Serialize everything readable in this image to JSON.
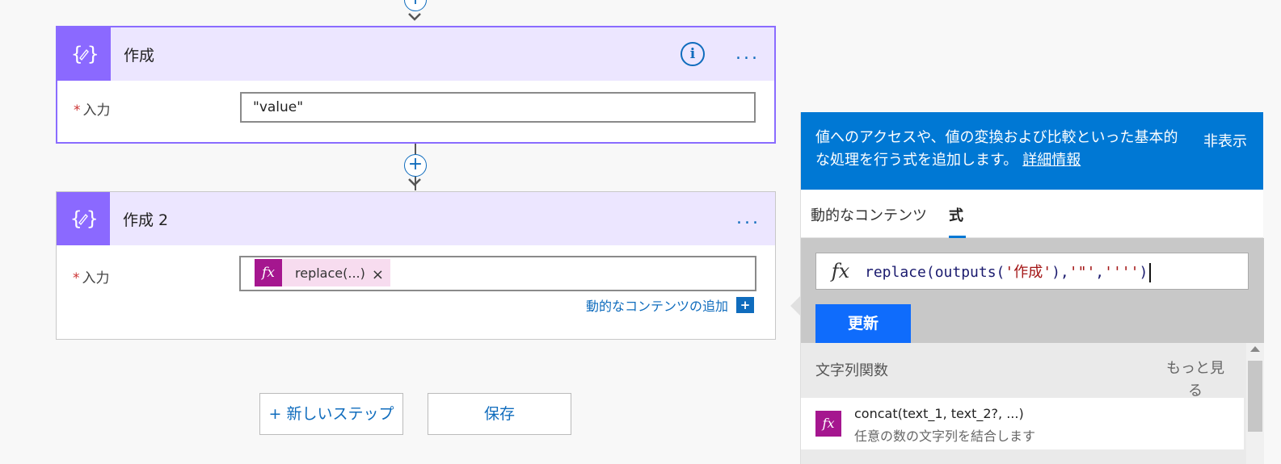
{
  "card1": {
    "title": "作成",
    "required_mark": "*",
    "input_label": "入力",
    "input_value": "\"value\""
  },
  "card2": {
    "title": "作成 2",
    "required_mark": "*",
    "input_label": "入力",
    "token_fx": "fx",
    "token_label": "replace(...)",
    "token_remove": "×",
    "dynamic_link": "動的なコンテンツの追加",
    "dynamic_plus": "+"
  },
  "icons": {
    "connector_plus": "+",
    "info": "i",
    "more": "..."
  },
  "buttons": {
    "new_step": "+ 新しいステップ",
    "save": "保存"
  },
  "panel": {
    "description": "値へのアクセスや、値の変換および比較といった基本的な処理を行う式を追加します。",
    "learn_more": "詳細情報",
    "hide": "非表示",
    "tabs": [
      "動的なコンテンツ",
      "式"
    ],
    "expr_fx": "fx",
    "expression_parts": {
      "p1": "replace(outputs(",
      "s1": "'作成'",
      "p2": "),",
      "s2": "'\"'",
      "p3": ",",
      "s3": "''''",
      "p4": ")"
    },
    "update_button": "更新",
    "section_title": "文字列関数",
    "see_more": "もっと見る",
    "functions": [
      {
        "fx": "fx",
        "name": "concat(text_1, text_2?, ...)",
        "description": "任意の数の文字列を結合します"
      }
    ]
  },
  "colors": {
    "accent_purple": "#8b69ff",
    "header_purple_bg": "#ece6ff",
    "link_blue": "#0f6cbd",
    "panel_blue": "#0078d4",
    "fx_magenta": "#a5168f"
  }
}
